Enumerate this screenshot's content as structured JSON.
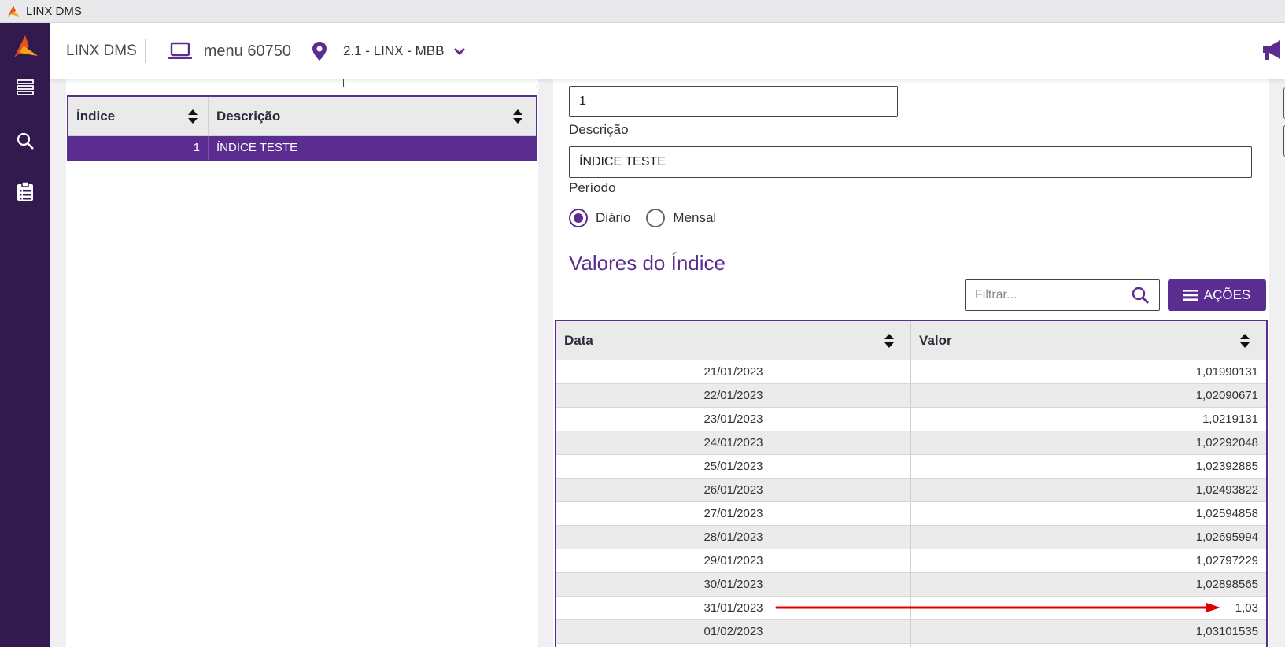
{
  "window": {
    "title": "LINX DMS"
  },
  "header": {
    "app_name": "LINX DMS",
    "menu_label": "menu 60750",
    "location_label": "2.1 - LINX - MBB"
  },
  "sidebar": {
    "items": [
      {
        "icon": "list-icon"
      },
      {
        "icon": "search-icon"
      },
      {
        "icon": "clipboard-icon"
      }
    ]
  },
  "left_grid": {
    "columns": [
      "Índice",
      "Descrição"
    ],
    "rows": [
      {
        "indice": "1",
        "descricao": "ÍNDICE TESTE"
      }
    ]
  },
  "form": {
    "codigo_value": "1",
    "descricao_label": "Descrição",
    "descricao_value": "ÍNDICE TESTE",
    "periodo_label": "Período",
    "periodo_options": [
      "Diário",
      "Mensal"
    ],
    "periodo_selected": "Diário"
  },
  "values_section": {
    "title": "Valores do Índice",
    "filter_placeholder": "Filtrar...",
    "actions_label": "AÇÕES",
    "columns": [
      "Data",
      "Valor"
    ],
    "rows": [
      {
        "data": "21/01/2023",
        "valor": "1,01990131"
      },
      {
        "data": "22/01/2023",
        "valor": "1,02090671"
      },
      {
        "data": "23/01/2023",
        "valor": "1,0219131"
      },
      {
        "data": "24/01/2023",
        "valor": "1,02292048"
      },
      {
        "data": "25/01/2023",
        "valor": "1,02392885"
      },
      {
        "data": "26/01/2023",
        "valor": "1,02493822"
      },
      {
        "data": "27/01/2023",
        "valor": "1,02594858"
      },
      {
        "data": "28/01/2023",
        "valor": "1,02695994"
      },
      {
        "data": "29/01/2023",
        "valor": "1,02797229"
      },
      {
        "data": "30/01/2023",
        "valor": "1,02898565"
      },
      {
        "data": "31/01/2023",
        "valor": "1,03"
      },
      {
        "data": "01/02/2023",
        "valor": "1,03101535"
      },
      {
        "data": "",
        "valor": ""
      }
    ]
  },
  "colors": {
    "brand_purple": "#5b2d91",
    "sidebar_bg": "#321a4e",
    "annotation_arrow": "#e00000"
  }
}
